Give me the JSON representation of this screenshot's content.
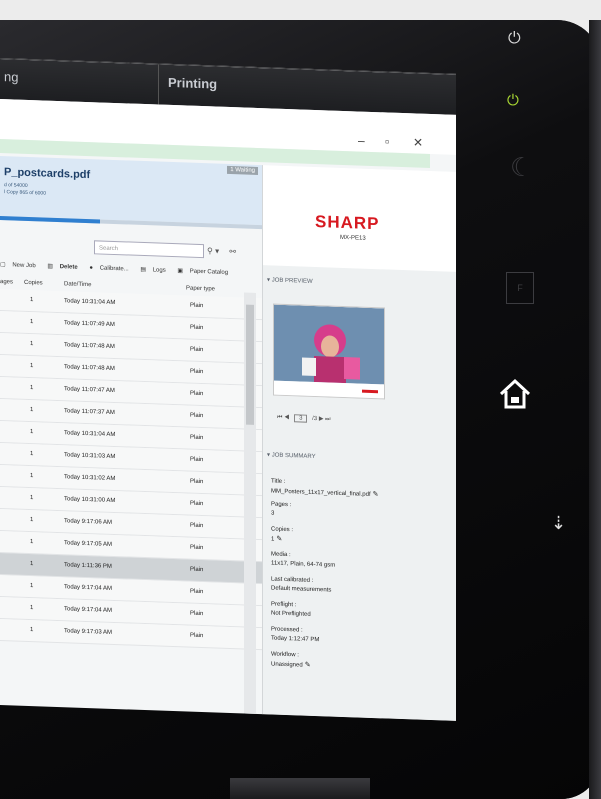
{
  "topbar": {
    "left_label": "ng",
    "right_label": "Printing"
  },
  "window": {
    "minimize": "–",
    "restore": "▫",
    "close": "✕"
  },
  "job_card": {
    "name": "P_postcards.pdf",
    "sub1": "d of 54000",
    "sub2": "l Copy 865 of 6000",
    "badge": "1 Waiting"
  },
  "search": {
    "placeholder": "Search"
  },
  "toolbar": {
    "new_job": "New Job",
    "delete": "Delete",
    "calibrate": "Calibrate...",
    "logs": "Logs",
    "paper_catalog": "Paper Catalog"
  },
  "table": {
    "headers": {
      "pages": "ages",
      "copies": "Copies",
      "datetime": "Date/Time",
      "papertype": "Paper type"
    },
    "rows": [
      {
        "copies": "1",
        "datetime": "Today 10:31:04 AM",
        "paper": "Plain"
      },
      {
        "copies": "1",
        "datetime": "Today 11:07:49 AM",
        "paper": "Plain"
      },
      {
        "copies": "1",
        "datetime": "Today 11:07:48 AM",
        "paper": "Plain"
      },
      {
        "copies": "1",
        "datetime": "Today 11:07:48 AM",
        "paper": "Plain"
      },
      {
        "copies": "1",
        "datetime": "Today 11:07:47 AM",
        "paper": "Plain"
      },
      {
        "copies": "1",
        "datetime": "Today 11:07:37 AM",
        "paper": "Plain"
      },
      {
        "copies": "1",
        "datetime": "Today 10:31:04 AM",
        "paper": "Plain"
      },
      {
        "copies": "1",
        "datetime": "Today 10:31:03 AM",
        "paper": "Plain"
      },
      {
        "copies": "1",
        "datetime": "Today 10:31:02 AM",
        "paper": "Plain"
      },
      {
        "copies": "1",
        "datetime": "Today 10:31:00 AM",
        "paper": "Plain"
      },
      {
        "copies": "1",
        "datetime": "Today 9:17:06 AM",
        "paper": "Plain"
      },
      {
        "copies": "1",
        "datetime": "Today 9:17:05 AM",
        "paper": "Plain"
      },
      {
        "copies": "1",
        "datetime": "Today 1:11:36 PM",
        "paper": "Plain",
        "selected": true
      },
      {
        "copies": "1",
        "datetime": "Today 9:17:04 AM",
        "paper": "Plain"
      },
      {
        "copies": "1",
        "datetime": "Today 9:17:04 AM",
        "paper": "Plain"
      },
      {
        "copies": "1",
        "datetime": "Today 9:17:03 AM",
        "paper": "Plain"
      }
    ]
  },
  "brand": {
    "logo": "SHARP",
    "model": "MX-PE13"
  },
  "job_preview": {
    "label": "JOB PREVIEW",
    "page_current": "3",
    "page_total": "/3"
  },
  "job_summary": {
    "label": "JOB SUMMARY",
    "title_label": "Title :",
    "title_value": "MM_Posters_11x17_vertical_final.pdf",
    "pages_label": "Pages :",
    "pages_value": "3",
    "copies_label": "Copies :",
    "copies_value": "1",
    "media_label": "Media :",
    "media_value": "11x17, Plain, 64-74 gsm",
    "calibrated_label": "Last calibrated :",
    "calibrated_value": "Default measurements",
    "preflight_label": "Preflight :",
    "preflight_value": "Not Preflighted",
    "processed_label": "Processed :",
    "processed_value": "Today 1:12:47 PM",
    "workflow_label": "Workflow :",
    "workflow_value": "Unassigned"
  },
  "side_icons": [
    "power-icon",
    "energy-save-icon",
    "sleep-moon-icon",
    "fiery-icon",
    "home-icon",
    "usb-icon"
  ],
  "colors": {
    "brand_red": "#d71920",
    "accent_green": "#9fd53a",
    "screen_bg": "#f4f6f7"
  }
}
